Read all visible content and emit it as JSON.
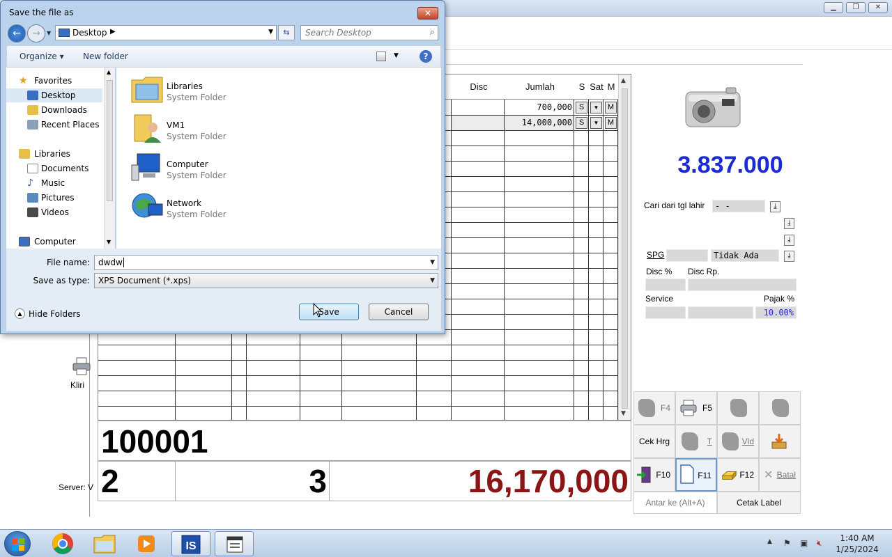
{
  "dialog": {
    "title": "Save the file as",
    "close_label": "✕",
    "address": "Desktop",
    "search_placeholder": "Search Desktop",
    "toolbar": {
      "organize": "Organize ▾",
      "new_folder": "New folder"
    },
    "nav": {
      "favorites": "Favorites",
      "desktop": "Desktop",
      "downloads": "Downloads",
      "recent_places": "Recent Places",
      "libraries": "Libraries",
      "documents": "Documents",
      "music": "Music",
      "pictures": "Pictures",
      "videos": "Videos",
      "computer": "Computer"
    },
    "files": [
      {
        "name": "Libraries",
        "type": "System Folder"
      },
      {
        "name": "VM1",
        "type": "System Folder"
      },
      {
        "name": "Computer",
        "type": "System Folder"
      },
      {
        "name": "Network",
        "type": "System Folder"
      }
    ],
    "file_name_label": "File name:",
    "file_name_value": "dwdw",
    "save_type_label": "Save as type:",
    "save_type_value": "XPS Document (*.xps)",
    "hide_folders": "Hide Folders",
    "save_button": "Save",
    "cancel_button": "Cancel"
  },
  "pos": {
    "columns": {
      "disc": "Disc",
      "jumlah": "Jumlah",
      "s": "S",
      "sat": "Sat",
      "m": "M"
    },
    "rows": [
      {
        "jumlah": "700,000",
        "s": "S",
        "m": "M"
      },
      {
        "jumlah": "14,000,000",
        "s": "S",
        "m": "M"
      }
    ],
    "item_code": "100001",
    "total_qty_left": "2",
    "total_qty_right": "3",
    "grand_total": "16,170,000",
    "price_display": "3.837.000",
    "cari_label": "Cari dari tgl lahir",
    "cari_value": "-  -",
    "spg_label": "SPG",
    "spg_value": "Tidak Ada",
    "disc_pct_label": "Disc %",
    "disc_rp_label": "Disc Rp.",
    "service_label": "Service",
    "pajak_label": "Pajak %",
    "pajak_value": "10.00%",
    "buttons": {
      "f4": "F4",
      "f5": "F5",
      "cek_hrg": "Cek Hrg",
      "t": "T",
      "vld": "Vld",
      "f10": "F10",
      "f11": "F11",
      "f12": "F12",
      "batal": "Batal",
      "antar": "Antar ke (Alt+A)",
      "cetak_label": "Cetak Label"
    },
    "desktop_label_kliring": "Kliri",
    "server_label": "Server: V"
  },
  "taskbar": {
    "time": "1:40 AM",
    "date": "1/25/2024"
  },
  "colors": {
    "price_blue": "#1a2bd6",
    "total_red": "#8b1414"
  }
}
